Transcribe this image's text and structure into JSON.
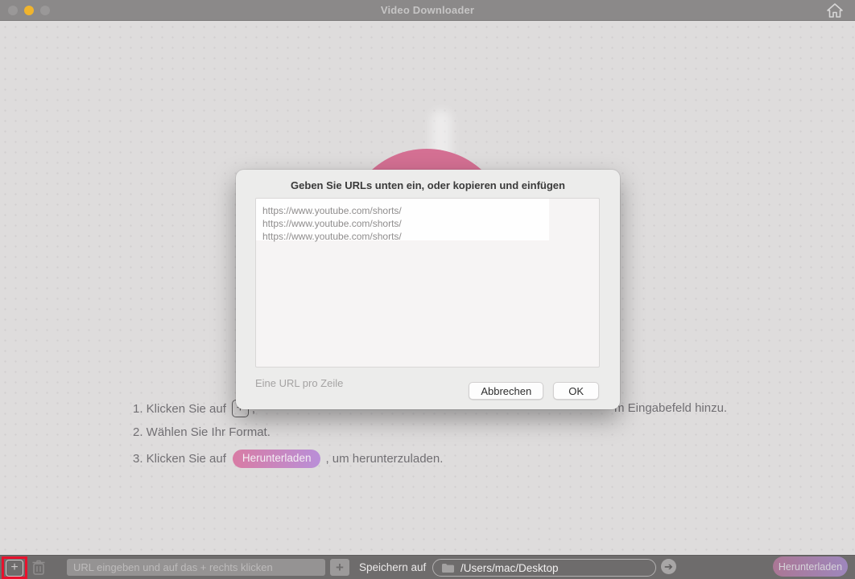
{
  "titlebar": {
    "title": "Video Downloader"
  },
  "instructions": {
    "step1_prefix": "1. Klicken Sie auf",
    "step1_comma": ",",
    "step1_suffix": "m Eingabefeld hinzu.",
    "step2": "2. Wählen Sie Ihr Format.",
    "step3_prefix": "3. Klicken Sie auf",
    "step3_badge": "Herunterladen",
    "step3_suffix": ", um herunterzuladen."
  },
  "dialog": {
    "title": "Geben Sie URLs unten ein, oder kopieren und einfügen",
    "urls": [
      "https://www.youtube.com/shorts/",
      "https://www.youtube.com/shorts/",
      "https://www.youtube.com/shorts/"
    ],
    "hint": "Eine URL pro Zeile",
    "cancel_label": "Abbrechen",
    "ok_label": "OK"
  },
  "toolbar": {
    "url_placeholder": "URL eingeben und auf das + rechts klicken",
    "add_plus_glyph": "+",
    "small_plus_glyph": "+",
    "save_label": "Speichern auf",
    "save_path": "/Users/mac/Desktop",
    "arrow_glyph": "➔",
    "download_label": "Herunterladen"
  },
  "colors": {
    "accent_pink": "#d47093",
    "accent_purple": "#b98fd8",
    "highlight_red": "#e8112d",
    "titlebar_gray": "#8b8989",
    "toolbar_gray": "#6e6c6c"
  }
}
